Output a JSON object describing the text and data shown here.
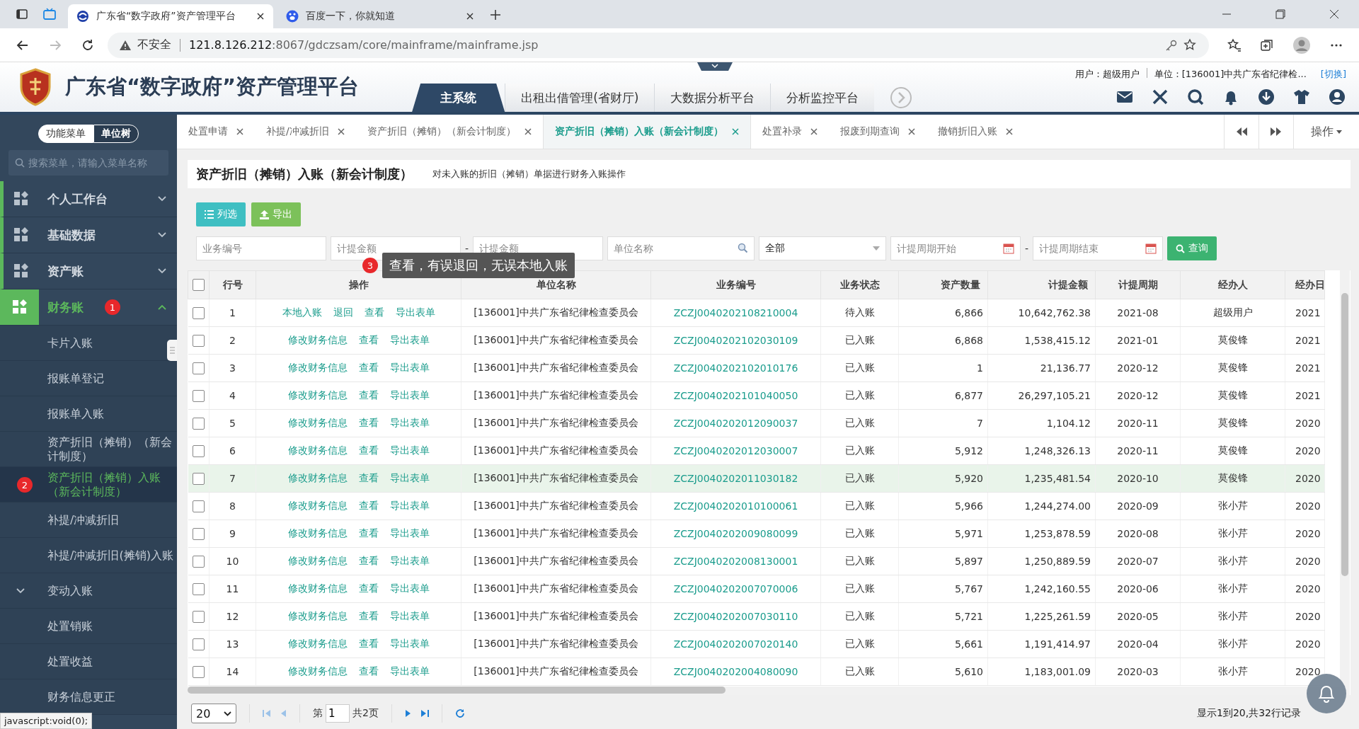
{
  "browser": {
    "tabs": [
      {
        "title": "广东省“数字政府”资产管理平台",
        "selected": true
      },
      {
        "title": "百度一下，你就知道",
        "selected": false
      }
    ],
    "security": "不安全",
    "url_host": "121.8.126.212",
    "url_rest": ":8067/gdczsam/core/mainframe/mainframe.jsp"
  },
  "header": {
    "title": "广东省“数字政府”资产管理平台",
    "user": "用户：超级用户",
    "unit": "单位：[136001]中共广东省纪律检...",
    "switch": "[切换]",
    "nav": [
      {
        "label": "主系统",
        "selected": true
      },
      {
        "label": "出租出借管理(省财厅)",
        "selected": false
      },
      {
        "label": "大数据分析平台",
        "selected": false
      },
      {
        "label": "分析监控平台",
        "selected": false
      }
    ]
  },
  "sidebar": {
    "modes": [
      {
        "label": "功能菜单",
        "selected": false
      },
      {
        "label": "单位树",
        "selected": true
      }
    ],
    "search": {
      "placeholder": "搜索菜单，请输入菜单名称"
    },
    "groups": [
      {
        "label": "个人工作台",
        "expanded": false,
        "selected": false
      },
      {
        "label": "基础数据",
        "expanded": false,
        "selected": false
      },
      {
        "label": "资产账",
        "expanded": false,
        "selected": false
      },
      {
        "label": "财务账",
        "expanded": true,
        "selected": true,
        "badge": "1",
        "children": [
          {
            "label": "卡片入账",
            "kind": "item",
            "selected": false
          },
          {
            "label": "报账单登记",
            "kind": "item",
            "selected": false
          },
          {
            "label": "报账单入账",
            "kind": "item",
            "selected": false
          },
          {
            "label": "资产折旧（摊销）（新会计制度）",
            "kind": "item",
            "selected": false
          },
          {
            "label": "资产折旧（摊销）入账（新会计制度）",
            "kind": "item",
            "selected": true,
            "badge": "2"
          },
          {
            "label": "补提/冲减折旧",
            "kind": "item",
            "selected": false
          },
          {
            "label": "补提/冲减折旧(摊销)入账",
            "kind": "item",
            "selected": false
          },
          {
            "label": "变动入账",
            "kind": "folder",
            "selected": false
          },
          {
            "label": "处置销账",
            "kind": "item",
            "selected": false
          },
          {
            "label": "处置收益",
            "kind": "item",
            "selected": false
          },
          {
            "label": "财务信息更正",
            "kind": "item",
            "selected": false
          }
        ]
      }
    ]
  },
  "page_tabs": [
    {
      "label": "处置申请",
      "selected": false
    },
    {
      "label": "补提/冲减折旧",
      "selected": false
    },
    {
      "label": "资产折旧（摊销）（新会计制度）",
      "selected": false
    },
    {
      "label": "资产折旧（摊销）入账（新会计制度）",
      "selected": true
    },
    {
      "label": "处置补录",
      "selected": false
    },
    {
      "label": "报废到期查询",
      "selected": false
    },
    {
      "label": "撤销折旧入账",
      "selected": false
    }
  ],
  "tab_menu": "操作",
  "page": {
    "title": "资产折旧（摊销）入账（新会计制度）",
    "description": "对未入账的折旧（摊销）单据进行财务入账操作"
  },
  "toolbar": [
    {
      "label": "列选",
      "kind": "columns"
    },
    {
      "label": "导出",
      "kind": "export"
    }
  ],
  "filters": [
    {
      "kind": "input",
      "placeholder": "业务编号"
    },
    {
      "kind": "input",
      "placeholder": "计提金额"
    },
    {
      "kind": "dash",
      "text": "-"
    },
    {
      "kind": "input",
      "placeholder": "计提金额"
    },
    {
      "kind": "search",
      "placeholder": "单位名称"
    },
    {
      "kind": "select",
      "value": "全部"
    },
    {
      "kind": "date",
      "placeholder": "计提周期开始"
    },
    {
      "kind": "dash",
      "text": "-"
    },
    {
      "kind": "date",
      "placeholder": "计提周期结束"
    }
  ],
  "query_button": "查询",
  "tooltip": {
    "badge": "3",
    "text": "查看，有误退回，无误本地入账"
  },
  "table": {
    "select_all_checked": false,
    "columns": [
      "行号",
      "操作",
      "单位名称",
      "业务编号",
      "业务状态",
      "资产数量",
      "计提金额",
      "计提周期",
      "经办人",
      "经办日"
    ],
    "rows": [
      {
        "no": "1",
        "actions": [
          "本地入账",
          "退回",
          "查看",
          "导出表单"
        ],
        "unit": "[136001]中共广东省纪律检查委员会",
        "code": "ZCZJ0040202108210004",
        "status": "待入账",
        "quantity": "6,866",
        "amount": "10,642,762.38",
        "period": "2021-08",
        "handler": "超级用户",
        "date": "2021",
        "checked": false,
        "selected": false
      },
      {
        "no": "2",
        "actions": [
          "修改财务信息",
          "查看",
          "导出表单"
        ],
        "unit": "[136001]中共广东省纪律检查委员会",
        "code": "ZCZJ0040202102030109",
        "status": "已入账",
        "quantity": "6,868",
        "amount": "1,538,415.12",
        "period": "2021-01",
        "handler": "莫俊锋",
        "date": "2021",
        "checked": false,
        "selected": false
      },
      {
        "no": "3",
        "actions": [
          "修改财务信息",
          "查看",
          "导出表单"
        ],
        "unit": "[136001]中共广东省纪律检查委员会",
        "code": "ZCZJ0040202102010176",
        "status": "已入账",
        "quantity": "1",
        "amount": "21,136.77",
        "period": "2020-12",
        "handler": "莫俊锋",
        "date": "2021",
        "checked": false,
        "selected": false
      },
      {
        "no": "4",
        "actions": [
          "修改财务信息",
          "查看",
          "导出表单"
        ],
        "unit": "[136001]中共广东省纪律检查委员会",
        "code": "ZCZJ0040202101040050",
        "status": "已入账",
        "quantity": "6,877",
        "amount": "26,297,105.21",
        "period": "2020-12",
        "handler": "莫俊锋",
        "date": "2021",
        "checked": false,
        "selected": false
      },
      {
        "no": "5",
        "actions": [
          "修改财务信息",
          "查看",
          "导出表单"
        ],
        "unit": "[136001]中共广东省纪律检查委员会",
        "code": "ZCZJ0040202012090037",
        "status": "已入账",
        "quantity": "7",
        "amount": "1,104.12",
        "period": "2020-11",
        "handler": "莫俊锋",
        "date": "2020",
        "checked": false,
        "selected": false
      },
      {
        "no": "6",
        "actions": [
          "修改财务信息",
          "查看",
          "导出表单"
        ],
        "unit": "[136001]中共广东省纪律检查委员会",
        "code": "ZCZJ0040202012030007",
        "status": "已入账",
        "quantity": "5,912",
        "amount": "1,248,326.13",
        "period": "2020-11",
        "handler": "莫俊锋",
        "date": "2020",
        "checked": false,
        "selected": false
      },
      {
        "no": "7",
        "actions": [
          "修改财务信息",
          "查看",
          "导出表单"
        ],
        "unit": "[136001]中共广东省纪律检查委员会",
        "code": "ZCZJ0040202011030182",
        "status": "已入账",
        "quantity": "5,920",
        "amount": "1,235,481.54",
        "period": "2020-10",
        "handler": "莫俊锋",
        "date": "2020",
        "checked": false,
        "selected": true
      },
      {
        "no": "8",
        "actions": [
          "修改财务信息",
          "查看",
          "导出表单"
        ],
        "unit": "[136001]中共广东省纪律检查委员会",
        "code": "ZCZJ0040202010100061",
        "status": "已入账",
        "quantity": "5,966",
        "amount": "1,244,274.00",
        "period": "2020-09",
        "handler": "张小芹",
        "date": "2020",
        "checked": false,
        "selected": false
      },
      {
        "no": "9",
        "actions": [
          "修改财务信息",
          "查看",
          "导出表单"
        ],
        "unit": "[136001]中共广东省纪律检查委员会",
        "code": "ZCZJ0040202009080099",
        "status": "已入账",
        "quantity": "5,971",
        "amount": "1,253,878.59",
        "period": "2020-08",
        "handler": "张小芹",
        "date": "2020",
        "checked": false,
        "selected": false
      },
      {
        "no": "10",
        "actions": [
          "修改财务信息",
          "查看",
          "导出表单"
        ],
        "unit": "[136001]中共广东省纪律检查委员会",
        "code": "ZCZJ0040202008130001",
        "status": "已入账",
        "quantity": "5,897",
        "amount": "1,250,889.59",
        "period": "2020-07",
        "handler": "张小芹",
        "date": "2020",
        "checked": false,
        "selected": false
      },
      {
        "no": "11",
        "actions": [
          "修改财务信息",
          "查看",
          "导出表单"
        ],
        "unit": "[136001]中共广东省纪律检查委员会",
        "code": "ZCZJ0040202007070006",
        "status": "已入账",
        "quantity": "5,767",
        "amount": "1,242,160.55",
        "period": "2020-06",
        "handler": "张小芹",
        "date": "2020",
        "checked": false,
        "selected": false
      },
      {
        "no": "12",
        "actions": [
          "修改财务信息",
          "查看",
          "导出表单"
        ],
        "unit": "[136001]中共广东省纪律检查委员会",
        "code": "ZCZJ0040202007030110",
        "status": "已入账",
        "quantity": "5,721",
        "amount": "1,225,261.59",
        "period": "2020-05",
        "handler": "张小芹",
        "date": "2020",
        "checked": false,
        "selected": false
      },
      {
        "no": "13",
        "actions": [
          "修改财务信息",
          "查看",
          "导出表单"
        ],
        "unit": "[136001]中共广东省纪律检查委员会",
        "code": "ZCZJ0040202007020140",
        "status": "已入账",
        "quantity": "5,661",
        "amount": "1,191,414.97",
        "period": "2020-04",
        "handler": "张小芹",
        "date": "2020",
        "checked": false,
        "selected": false
      },
      {
        "no": "14",
        "actions": [
          "修改财务信息",
          "查看",
          "导出表单"
        ],
        "unit": "[136001]中共广东省纪律检查委员会",
        "code": "ZCZJ0040202004080090",
        "status": "已入账",
        "quantity": "5,610",
        "amount": "1,183,001.09",
        "period": "2020-03",
        "handler": "张小芹",
        "date": "2020",
        "checked": false,
        "selected": false
      }
    ]
  },
  "pagination": {
    "page_size": "20",
    "page_prefix": "第",
    "page": "1",
    "page_suffix": "共2页",
    "summary": "显示1到20,共32行记录"
  },
  "status_tooltip": "javascript:void(0);"
}
